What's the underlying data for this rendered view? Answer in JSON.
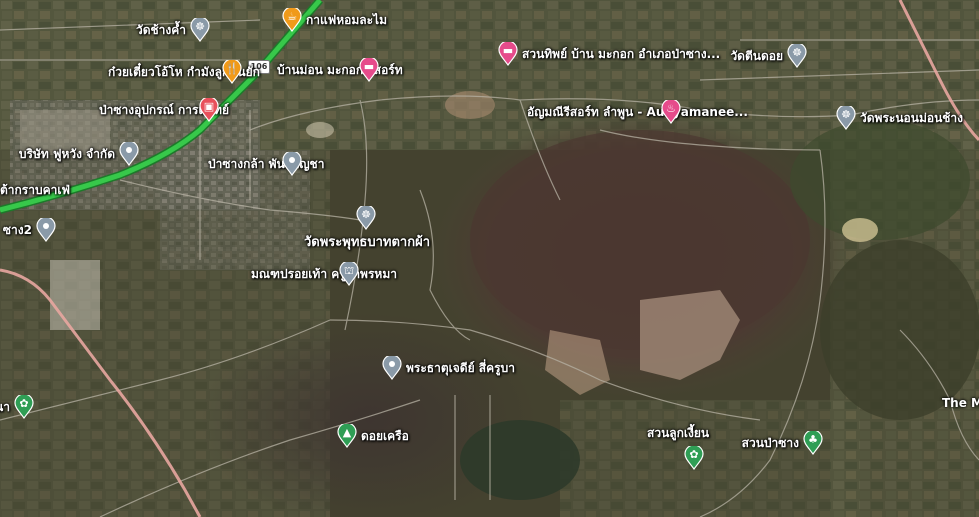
{
  "map": {
    "colors": {
      "road_highway": "#37c84a",
      "road_rail": "#e8a6a0",
      "pin_red": "#e8505b",
      "pin_pink": "#e64b8b",
      "pin_orange": "#f09a1a",
      "pin_gray": "#8a9aa8",
      "pin_green": "#2f9e55"
    },
    "highway_shield": "106",
    "pois": [
      {
        "name": "วัดช้างค้ำ",
        "icon": "temple-icon",
        "color": "gray"
      },
      {
        "name": "กาแฟหอมละไม",
        "icon": "cafe-icon",
        "color": "orange"
      },
      {
        "name": "ก๋วยเตี๋ยวโอ้โห กำมังลูกชิ้นยัก",
        "icon": "restaurant-icon",
        "color": "orange"
      },
      {
        "name": "ป่าซางอุปกรณ์ การแพทย์",
        "icon": "shopping-icon",
        "color": "red"
      },
      {
        "name": "บ้านม่อน มะกอก รีสอร์ท",
        "icon": "hotel-icon",
        "color": "pink"
      },
      {
        "name": "สวนทิพย์ บ้าน มะกอก อำเภอป่าซาง...",
        "icon": "hotel-icon",
        "color": "pink"
      },
      {
        "name": "วัดตีนดอย",
        "icon": "temple-icon",
        "color": "gray"
      },
      {
        "name": "อัญมณีรีสอร์ท ลำพูน - Aunyamanee...",
        "icon": "spa-icon",
        "color": "pink"
      },
      {
        "name": "วัดพระนอนม่อนช้าง",
        "icon": "temple-icon",
        "color": "gray"
      },
      {
        "name": "บริษัท ฟูหวัง จำกัด",
        "icon": "place-icon",
        "color": "gray"
      },
      {
        "name": "ป่าซางกล้า พันธุ์กัญชา",
        "icon": "place-icon",
        "color": "gray"
      },
      {
        "name": "ต้ากราบคาเฟ่",
        "icon": "",
        "color": ""
      },
      {
        "name": "ซาง2",
        "icon": "place-icon",
        "color": "gray"
      },
      {
        "name": "วัดพระพุทธบาทตากผ้า",
        "icon": "temple-icon",
        "color": "gray"
      },
      {
        "name": "มณฑปรอยเท้า ครูบาพรหมา",
        "icon": "monument-icon",
        "color": "gray"
      },
      {
        "name": "พระธาตุเจดีย์ สี่ครูบา",
        "icon": "place-icon",
        "color": "gray"
      },
      {
        "name": "รีรธนา",
        "icon": "garden-icon",
        "color": "green"
      },
      {
        "name": "ดอยเครือ",
        "icon": "mountain-icon",
        "color": "green"
      },
      {
        "name": "สวนลูกเงี้ยน",
        "icon": "garden-icon",
        "color": "green"
      },
      {
        "name": "สวนป่าซาง",
        "icon": "park-icon",
        "color": "green"
      },
      {
        "name": "The M",
        "icon": "",
        "color": ""
      }
    ]
  }
}
